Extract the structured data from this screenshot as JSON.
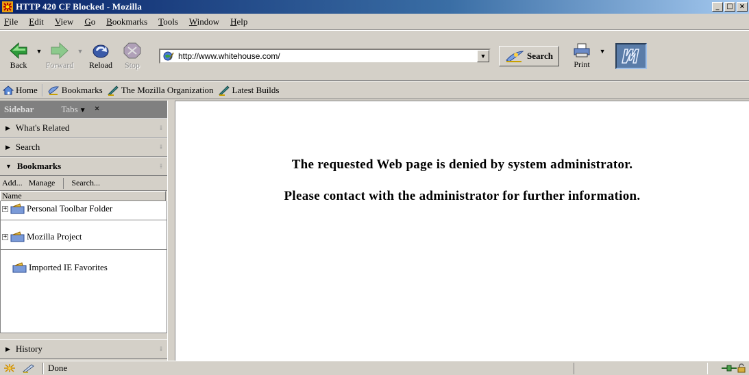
{
  "window": {
    "title": "HTTP 420 CF Blocked - Mozilla",
    "buttons": {
      "minimize": "_",
      "maximize": "□",
      "close": "×"
    }
  },
  "menubar": {
    "items": [
      "File",
      "Edit",
      "View",
      "Go",
      "Bookmarks",
      "Tools",
      "Window",
      "Help"
    ]
  },
  "navigation": {
    "back": {
      "label": "Back",
      "icon": "back-arrow-icon"
    },
    "forward": {
      "label": "Forward",
      "icon": "forward-arrow-icon",
      "disabled": true
    },
    "reload": {
      "label": "Reload",
      "icon": "reload-icon"
    },
    "stop": {
      "label": "Stop",
      "icon": "stop-icon",
      "disabled": true
    },
    "url": "http://www.whitehouse.com/",
    "search_label": "Search",
    "print_label": "Print"
  },
  "personal_toolbar": {
    "items": [
      {
        "label": "Home",
        "icon": "home-icon"
      },
      {
        "label": "Bookmarks",
        "icon": "bookmarks-icon"
      },
      {
        "label": "The Mozilla Organization",
        "icon": "bookmark-link-icon"
      },
      {
        "label": "Latest Builds",
        "icon": "bookmark-link-icon"
      }
    ]
  },
  "sidebar": {
    "title": "Sidebar",
    "tabs_label": "Tabs",
    "close": "×",
    "panels": [
      {
        "label": "What's Related",
        "open": false
      },
      {
        "label": "Search",
        "open": false
      },
      {
        "label": "Bookmarks",
        "open": true
      },
      {
        "label": "History",
        "open": false
      }
    ],
    "bookmark_tools": {
      "add": "Add...",
      "manage": "Manage",
      "search": "Search..."
    },
    "column_header": "Name",
    "tree": [
      {
        "label": "Personal Toolbar Folder",
        "expandable": true
      },
      {
        "label": "Mozilla Project",
        "expandable": true
      },
      {
        "label": "Imported IE Favorites",
        "expandable": false
      }
    ]
  },
  "content": {
    "line1": "The requested Web page is denied by system administrator.",
    "line2": "Please contact with the administrator for further information."
  },
  "statusbar": {
    "status_text": "Done"
  },
  "colors": {
    "chrome": "#d4d0c8",
    "titlebar_start": "#0a246a",
    "titlebar_end": "#a6caf0",
    "content_bg": "#ffffff"
  }
}
